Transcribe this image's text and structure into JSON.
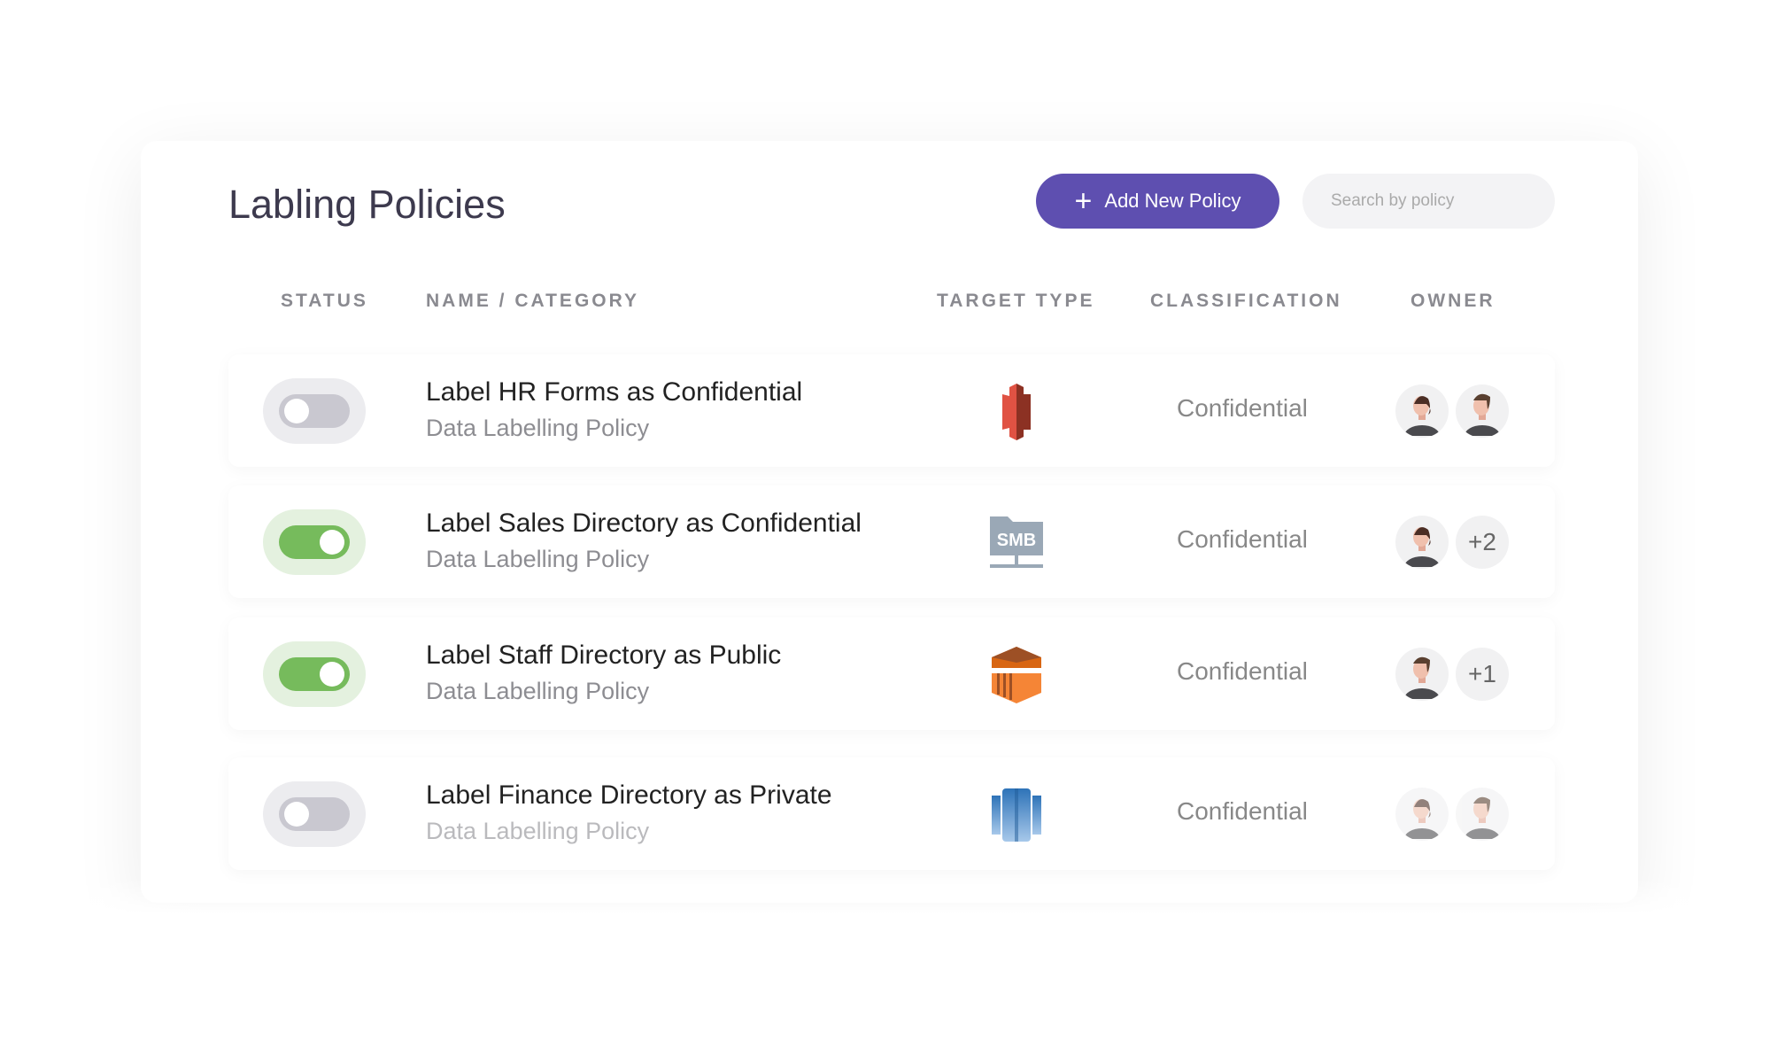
{
  "header": {
    "title": "Labling Policies",
    "add_button": "Add New Policy",
    "search_placeholder": "Search by policy"
  },
  "columns": [
    "STATUS",
    "NAME / CATEGORY",
    "TARGET TYPE",
    "CLASSIFICATION",
    "OWNER"
  ],
  "colors": {
    "accent": "#5e4fb0",
    "toggle_on": "#76bb5c",
    "toggle_off": "#c9c8d0"
  },
  "rows": [
    {
      "enabled": false,
      "name": "Label HR Forms as Confidential",
      "category": "Data Labelling Policy",
      "target_icon": "aws-s3-icon",
      "target_label": "",
      "classification": "Confidential",
      "owners": [
        "female-avatar",
        "male-avatar"
      ],
      "extra": ""
    },
    {
      "enabled": true,
      "name": "Label Sales Directory as Confidential",
      "category": "Data Labelling Policy",
      "target_icon": "smb-share-icon",
      "target_label": "SMB",
      "classification": "Confidential",
      "owners": [
        "female-avatar"
      ],
      "extra": "+2"
    },
    {
      "enabled": true,
      "name": "Label Staff Directory as Public",
      "category": "Data Labelling Policy",
      "target_icon": "aws-ec2-container-icon",
      "target_label": "",
      "classification": "Confidential",
      "owners": [
        "male-avatar"
      ],
      "extra": "+1"
    },
    {
      "enabled": false,
      "name": "Label Finance Directory as Private",
      "category": "Data Labelling Policy",
      "target_icon": "aws-redshift-icon",
      "target_label": "",
      "classification": "Confidential",
      "owners": [
        "female-avatar",
        "male-avatar"
      ],
      "extra": ""
    }
  ]
}
